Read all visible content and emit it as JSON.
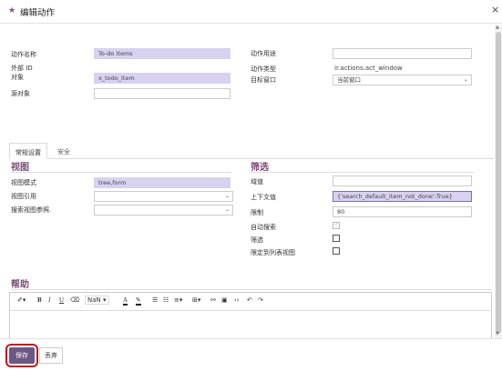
{
  "header": {
    "title": "编辑动作"
  },
  "form": {
    "left": {
      "action_name_label": "动作名称",
      "action_name_value": "To-do Items",
      "external_id_label": "外部 ID",
      "model_label": "对象",
      "model_value": "x_todo_item",
      "source_model_label": "源对象",
      "source_model_value": ""
    },
    "right": {
      "usage_label": "动作用途",
      "usage_value": "",
      "type_label": "动作类型",
      "type_value": "ir.actions.act_window",
      "target_label": "目标窗口",
      "target_value": "当前窗口"
    }
  },
  "tabs": [
    {
      "label": "常规设置"
    },
    {
      "label": "安全"
    }
  ],
  "views_section": {
    "title": "视图",
    "view_mode_label": "视图模式",
    "view_mode_value": "tree,form",
    "view_ref_label": "视图引用",
    "view_ref_value": "",
    "search_view_label": "搜索视图参照.",
    "search_view_value": ""
  },
  "filter_section": {
    "title": "筛选",
    "domain_label": "域值",
    "domain_value": "",
    "context_label": "上下文值",
    "context_value": "{'search_default_item_not_done':True}",
    "limit_label": "限制",
    "limit_value": "80",
    "auto_search_label": "自动搜索",
    "auto_search_checked": true,
    "filter_label": "筛选",
    "filter_checked": false,
    "restrict_label": "限定到列表视图",
    "restrict_checked": false
  },
  "help_section": {
    "title": "帮助",
    "font_size": "NaN",
    "toolbar_letters": [
      "B",
      "I",
      "U",
      "A"
    ]
  },
  "footer": {
    "save_label": "保存",
    "discard_label": "丢弃"
  },
  "colors": {
    "accent": "#7a4a74",
    "primary_button": "#6d5783",
    "required_field": "#d8d2f0",
    "highlight_border": "#c0161c"
  }
}
